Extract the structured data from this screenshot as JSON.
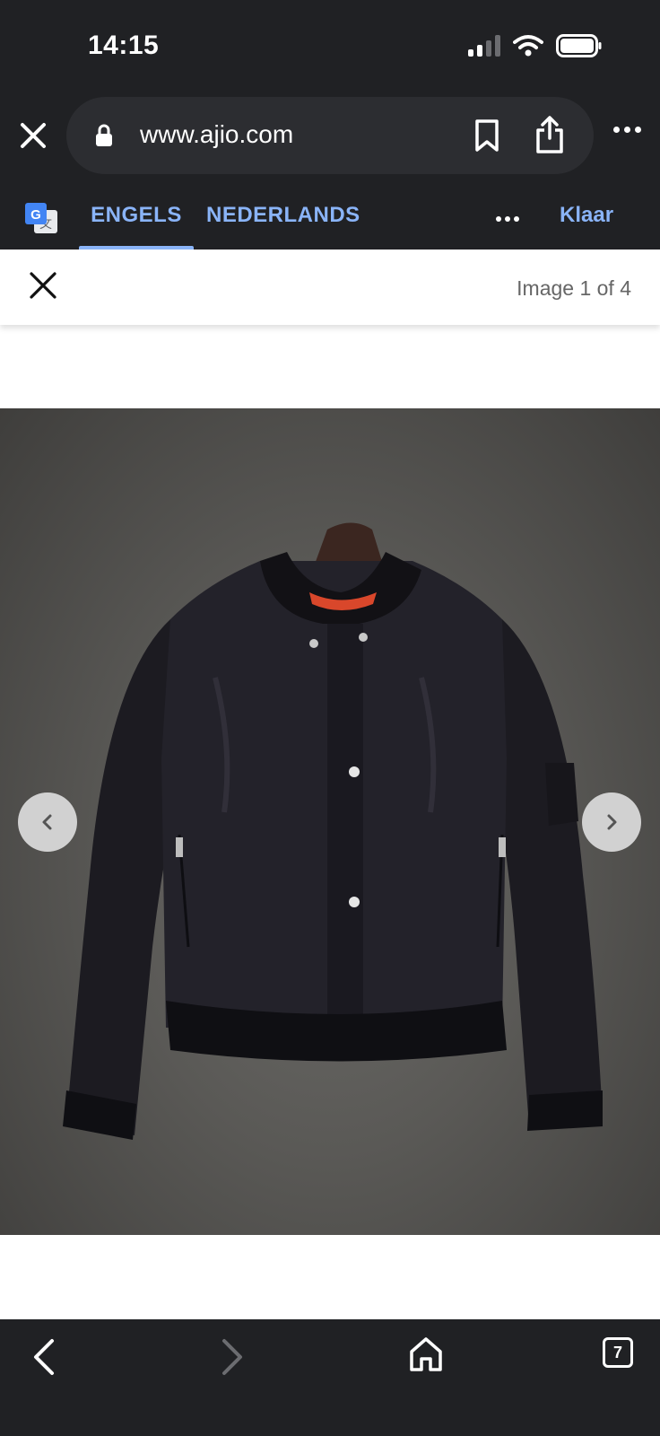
{
  "status_bar": {
    "time": "14:15"
  },
  "browser": {
    "url": "www.ajio.com"
  },
  "translate_bar": {
    "tab_source": "ENGELS",
    "tab_target": "NEDERLANDS",
    "done_label": "Klaar"
  },
  "viewer": {
    "counter": "Image 1 of 4"
  },
  "bottom_bar": {
    "tab_count": "7"
  },
  "colors": {
    "chrome_bg": "#202124",
    "accent": "#8ab4f8"
  },
  "icons": [
    "signal-icon",
    "wifi-icon",
    "battery-icon",
    "close-icon",
    "lock-icon",
    "bookmark-icon",
    "share-icon",
    "more-icon",
    "google-translate-icon",
    "chevron-left-icon",
    "chevron-right-icon",
    "back-icon",
    "forward-icon",
    "home-icon",
    "tabs-icon"
  ]
}
